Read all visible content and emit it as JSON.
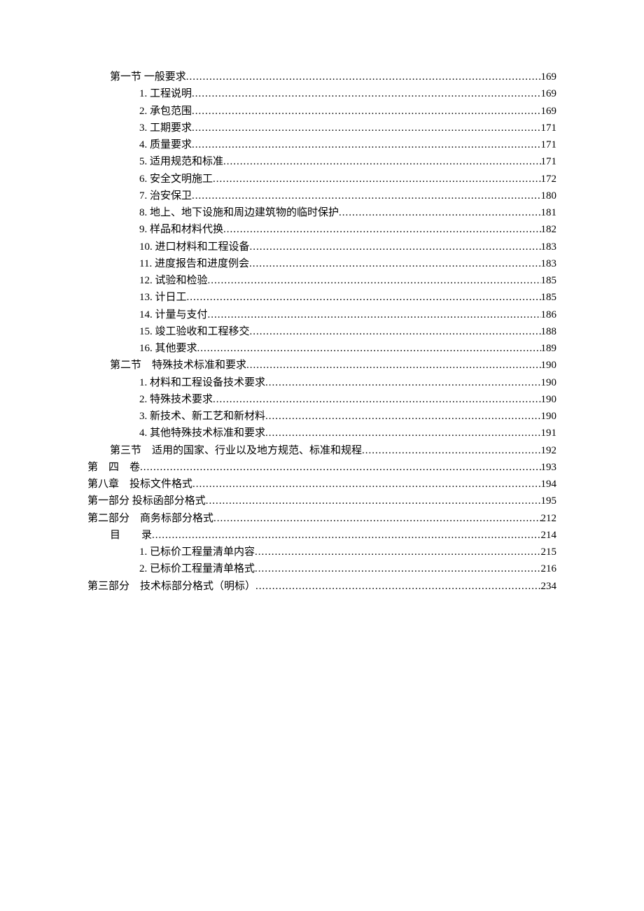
{
  "toc": [
    {
      "indent": 1,
      "label": "第一节  一般要求",
      "page": "169"
    },
    {
      "indent": 2,
      "label": "1. 工程说明",
      "page": "169"
    },
    {
      "indent": 2,
      "label": "2. 承包范围",
      "page": "169"
    },
    {
      "indent": 2,
      "label": "3. 工期要求",
      "page": "171"
    },
    {
      "indent": 2,
      "label": "4. 质量要求",
      "page": "171"
    },
    {
      "indent": 2,
      "label": "5. 适用规范和标准",
      "page": "171"
    },
    {
      "indent": 2,
      "label": "6. 安全文明施工",
      "page": "172"
    },
    {
      "indent": 2,
      "label": "7. 治安保卫",
      "page": "180"
    },
    {
      "indent": 2,
      "label": "8. 地上、地下设施和周边建筑物的临时保护",
      "page": "181"
    },
    {
      "indent": 2,
      "label": "9. 样品和材料代换",
      "page": "182"
    },
    {
      "indent": 2,
      "label": "10. 进口材料和工程设备",
      "page": "183"
    },
    {
      "indent": 2,
      "label": "11. 进度报告和进度例会",
      "page": "183"
    },
    {
      "indent": 2,
      "label": "12. 试验和检验",
      "page": "185"
    },
    {
      "indent": 2,
      "label": "13. 计日工",
      "page": "185"
    },
    {
      "indent": 2,
      "label": "14. 计量与支付",
      "page": "186"
    },
    {
      "indent": 2,
      "label": "15. 竣工验收和工程移交",
      "page": "188"
    },
    {
      "indent": 2,
      "label": "16. 其他要求",
      "page": "189"
    },
    {
      "indent": 1,
      "label": "第二节　特殊技术标准和要求",
      "page": "190"
    },
    {
      "indent": 2,
      "label": "1. 材料和工程设备技术要求",
      "page": "190"
    },
    {
      "indent": 2,
      "label": "2. 特殊技术要求",
      "page": "190"
    },
    {
      "indent": 2,
      "label": "3. 新技术、新工艺和新材料",
      "page": "190"
    },
    {
      "indent": 2,
      "label": "4. 其他特殊技术标准和要求",
      "page": "191"
    },
    {
      "indent": 1,
      "label": "第三节　适用的国家、行业以及地方规范、标准和规程",
      "page": "192"
    },
    {
      "indent": 0,
      "label": "第　四　卷",
      "page": "193"
    },
    {
      "indent": 0,
      "label": "第八章　投标文件格式",
      "page": "194"
    },
    {
      "indent": 0,
      "label": "第一部分  投标函部分格式",
      "page": "195"
    },
    {
      "indent": 0,
      "label": "第二部分　商务标部分格式",
      "page": "212"
    },
    {
      "indent": 1,
      "label": "目　　录",
      "page": "214"
    },
    {
      "indent": 2,
      "label": "1. 已标价工程量清单内容",
      "page": "215"
    },
    {
      "indent": 2,
      "label": "2. 已标价工程量清单格式",
      "page": "216"
    },
    {
      "indent": 0,
      "label": "第三部分　技术标部分格式（明标）",
      "page": "234"
    }
  ]
}
